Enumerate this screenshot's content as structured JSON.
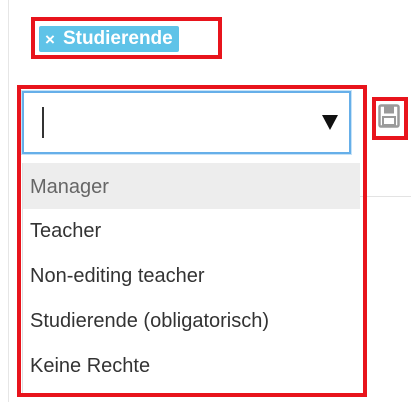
{
  "tag": {
    "remove_symbol": "×",
    "label": "Studierende"
  },
  "role_select": {
    "input_value": "",
    "options": [
      "Manager",
      "Teacher",
      "Non-editing teacher",
      "Studierende (obligatorisch)",
      "Keine Rechte"
    ]
  },
  "icons": {
    "dropdown_arrow": "triangle-down",
    "save": "floppy-disk"
  },
  "colors": {
    "highlight": "#e8141c",
    "tag_background": "#5fc3e8",
    "focus_border": "#66afe9",
    "option_hover": "#ededed"
  }
}
